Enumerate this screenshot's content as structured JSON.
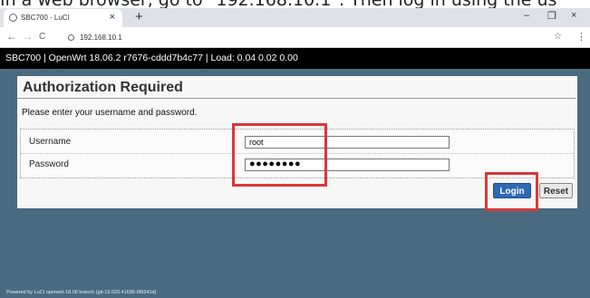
{
  "caption": "In a web browser, go to \"192.168.10.1\". Then log in using the us",
  "browser": {
    "tab_title": "SBC700 - LuCI",
    "tab_close": "×",
    "new_tab": "+",
    "minimize": "–",
    "maximize": "❐",
    "close": "×",
    "back": "←",
    "forward": "→",
    "reload": "C",
    "url": "192.168.10.1",
    "bookmark": "☆",
    "menu": "⋮"
  },
  "luci": {
    "header": "SBC700 | OpenWrt 18.06.2 r7676-cddd7b4c77 | Load: 0.04 0.02 0.00",
    "title": "Authorization Required",
    "description": "Please enter your username and password.",
    "username_label": "Username",
    "username_value": "root",
    "password_label": "Password",
    "password_value": "●●●●●●●●",
    "login_label": "Login",
    "reset_label": "Reset",
    "footer": "Powered by LuCI openwrt-18.06 branch (git-19.020.41695-6f6641d)"
  },
  "colors": {
    "highlight": "#d8383a",
    "login_button": "#2f68b3",
    "page_background": "#4a6a80"
  }
}
